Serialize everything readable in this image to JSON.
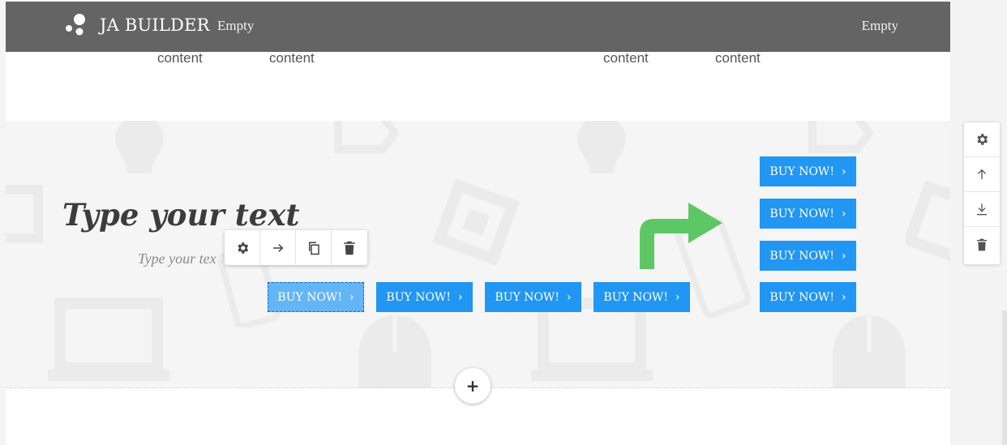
{
  "header": {
    "brand": "JA BUILDER",
    "subtitle": "Empty",
    "right_label": "Empty",
    "icons": [
      "ja-builder-logo-icon"
    ]
  },
  "top_section": {
    "content_labels": [
      "content",
      "content",
      "content",
      "content"
    ]
  },
  "hero": {
    "heading": "Type your text",
    "subtext": "Type your tex",
    "buttons": [
      "BUY NOW!",
      "BUY NOW!",
      "BUY NOW!",
      "BUY NOW!",
      "BUY NOW!",
      "BUY NOW!",
      "BUY NOW!",
      "BUY NOW!"
    ],
    "button_chevron": "›"
  },
  "element_toolbar": {
    "icons": [
      "gear-icon",
      "arrow-right-icon",
      "copy-icon",
      "trash-icon"
    ]
  },
  "section_toolbar": {
    "icons": [
      "gear-icon",
      "arrow-up-icon",
      "download-icon",
      "trash-icon"
    ]
  },
  "add_section": {
    "label": "+"
  },
  "colors": {
    "header_bg": "#646464",
    "button_blue": "#2196f3",
    "selected_button": "#64b5f6",
    "arrow_green": "#5ec765",
    "section_bg": "#f4f5f4"
  }
}
